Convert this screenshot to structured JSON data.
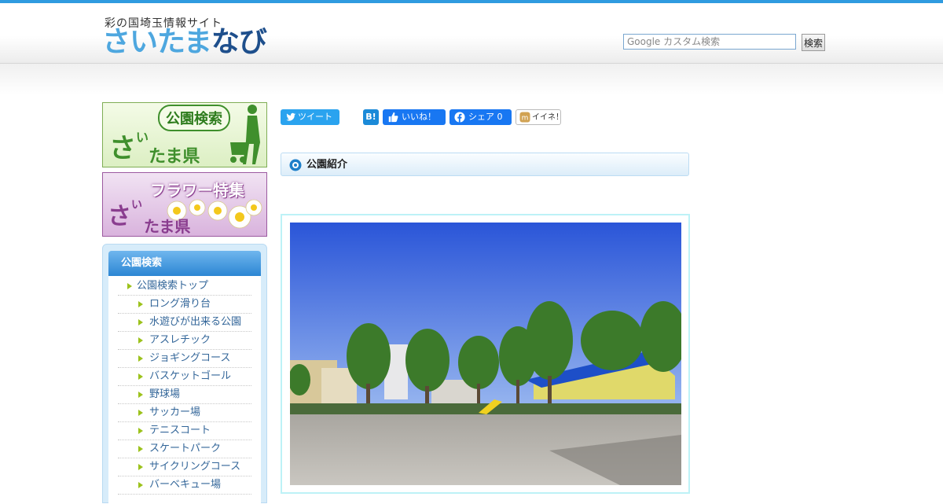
{
  "header": {
    "tagline": "彩の国埼玉情報サイト",
    "logo_part1": "さいたま",
    "logo_part2": "なび"
  },
  "search": {
    "placeholder": "Google カスタム検索",
    "button_label": "検索"
  },
  "banners": {
    "park": {
      "bubble": "公園検索",
      "big": "さ",
      "small": "い",
      "ken": "たま県"
    },
    "flower": {
      "title": "フラワー特集",
      "big": "さ",
      "small": "い",
      "ken": "たま県"
    }
  },
  "sidemenu": {
    "title": "公園検索",
    "items": [
      {
        "label": "公園検索トップ",
        "level": "top"
      },
      {
        "label": "ロング滑り台",
        "level": "sub"
      },
      {
        "label": "水遊びが出来る公園",
        "level": "sub"
      },
      {
        "label": "アスレチック",
        "level": "sub"
      },
      {
        "label": "ジョギングコース",
        "level": "sub"
      },
      {
        "label": "バスケットゴール",
        "level": "sub"
      },
      {
        "label": "野球場",
        "level": "sub"
      },
      {
        "label": "サッカー場",
        "level": "sub"
      },
      {
        "label": "テニスコート",
        "level": "sub"
      },
      {
        "label": "スケートパーク",
        "level": "sub"
      },
      {
        "label": "サイクリングコース",
        "level": "sub"
      },
      {
        "label": "バーベキュー場",
        "level": "sub"
      }
    ]
  },
  "social": {
    "tweet": "ツイート",
    "hatena": "B!",
    "like": "いいね！",
    "share": "シェア 0",
    "mixi": "イイネ！"
  },
  "section": {
    "title": "公園紹介"
  },
  "colors": {
    "accent": "#2f9be0",
    "menu_link": "#336699",
    "park_green": "#3f8f2c",
    "flower_purple": "#8a3d8f"
  }
}
